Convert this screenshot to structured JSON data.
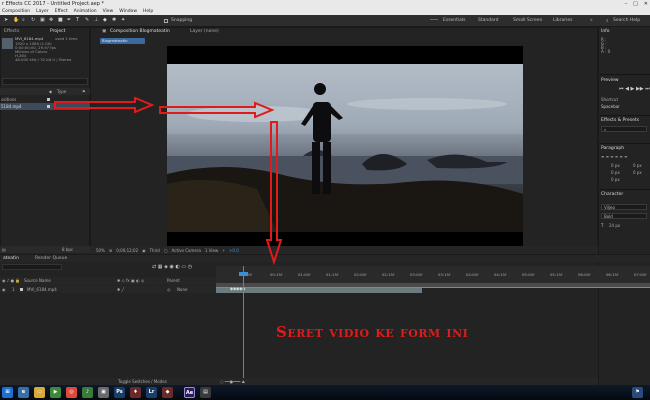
{
  "app": {
    "title": "r Effects CC 2017 - Untitled Project.aep *",
    "window_controls": [
      "–",
      "□",
      "✕"
    ]
  },
  "menu": [
    "Composition",
    "Layer",
    "Effect",
    "Animation",
    "View",
    "Window",
    "Help"
  ],
  "toolbar": {
    "snapping_label": "Snapping",
    "workspaces": [
      "Essentials",
      "Standard",
      "Small Screen",
      "Libraries"
    ],
    "search_help": "Search Help"
  },
  "project": {
    "tab_effects": "Effects",
    "tab_project": "Project",
    "item_name": "MVI_6184.mp4",
    "used": "used 1 time",
    "meta": [
      "1920 x 1080 (1.00)",
      "0:00:00:00, 29.97 fps",
      "Millions of Colors",
      "H.264",
      "48.000 kHz / 32 bit U / Stereo"
    ],
    "col_type": "Type",
    "col_comment": "Comment",
    "rows": [
      {
        "name": "ositions",
        "selected": false
      },
      {
        "name": "5184.mp4",
        "selected": true
      }
    ],
    "bpc": "8 bpc"
  },
  "comp": {
    "tab_comp": "Composition Blogmateatin",
    "tab_layer": "Layer (none)",
    "badge": "Blogmateatin",
    "viewer": {
      "zoom": "50%",
      "timecode": "0;00;12;02",
      "resolution": "Third",
      "camera": "Active Camera",
      "views": "1 View",
      "exposure": "+0.0"
    }
  },
  "right": {
    "info_title": "Info",
    "info_lines": [
      "R :",
      "G :",
      "B :",
      "A : 0"
    ],
    "preview_title": "Preview",
    "shortcut_label": "Shortcut",
    "shortcut_value": "Spacebar",
    "effects_title": "Effects & Presets",
    "paragraph_title": "Paragraph",
    "para_values": [
      "0 px",
      "0 px",
      "0 px",
      "0 px",
      "0 px"
    ],
    "character_title": "Character",
    "font_value": "Viljeo",
    "style_value": "Bold",
    "size_value": "24 px"
  },
  "timeline": {
    "tab_comp": "ateatin",
    "tab_render": "Render Queue",
    "col_source": "Source Name",
    "col_parent": "Parent",
    "layer_index": "1",
    "layer_name": "MVI_6184.mp4",
    "layer_parent": "None",
    "ticks": [
      "0:00f",
      "00:15f",
      "01:00f",
      "01:15f",
      "02:00f",
      "02:15f",
      "03:00f",
      "03:15f",
      "04:00f",
      "04:15f",
      "05:00f",
      "05:15f",
      "06:00f",
      "06:15f",
      "07:00f"
    ],
    "footer": "Toggle Switches / Modes"
  },
  "annotation": {
    "caption": "Seret vidio ke form ini",
    "color": "#e01b1b"
  },
  "colors": {
    "accent": "#3a8fd8",
    "panel": "#232323",
    "selection": "#3d4a5c"
  }
}
